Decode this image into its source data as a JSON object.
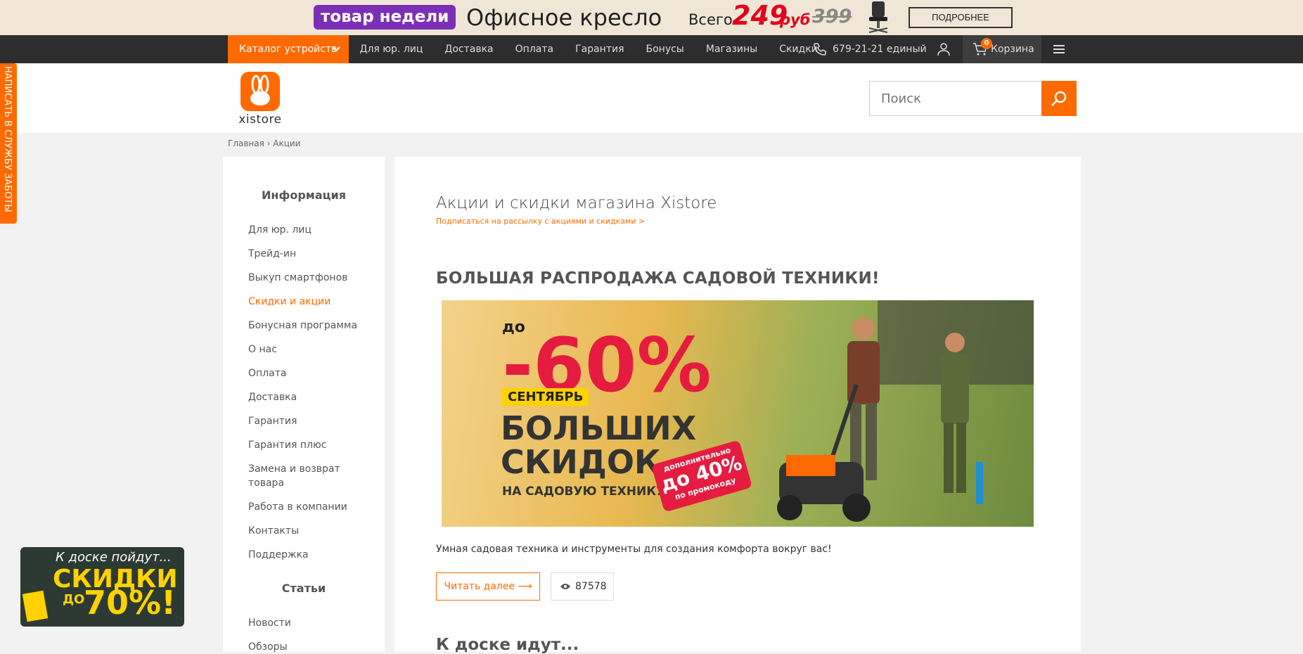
{
  "promo": {
    "badge": "товар недели",
    "title": "Офисное кресло",
    "price_label": "Всего",
    "price": "249",
    "currency": "руб",
    "old_price": "399",
    "more_button": "ПОДРОБНЕЕ"
  },
  "nav": {
    "catalog": "Каталог устройств",
    "links": [
      "Для юр. лиц",
      "Доставка",
      "Оплата",
      "Гарантия",
      "Бонусы",
      "Магазины",
      "Скидки"
    ],
    "phone": "679-21-21 единый",
    "cart_label": "Корзина",
    "cart_count": "0"
  },
  "header": {
    "logo_text": "xistore",
    "search_placeholder": "Поиск"
  },
  "side_tab": "НАПИСАТЬ В СЛУЖБУ ЗАБОТЫ",
  "breadcrumb": "Главная › Акции",
  "sidebar": {
    "heading_info": "Информация",
    "items": [
      "Для юр. лиц",
      "Трейд-ин",
      "Выкуп смартфонов",
      "Скидки и акции",
      "Бонусная программа",
      "О нас",
      "Оплата",
      "Доставка",
      "Гарантия",
      "Гарантия плюс",
      "Замена и возврат товара",
      "Работа в компании",
      "Контакты",
      "Поддержка"
    ],
    "heading_articles": "Статьи",
    "article_items": [
      "Новости",
      "Обзоры"
    ]
  },
  "main": {
    "page_title": "Акции и скидки магазина Xistore",
    "subscribe": "Подписаться на рассылку с акциями и скидками >",
    "article_title": "БОЛЬШАЯ РАСПРОДАЖА САДОВОЙ ТЕХНИКИ!",
    "image": {
      "do": "до",
      "percent": "-60%",
      "month": "СЕНТЯБРЬ",
      "line1": "БОЛЬШИХ",
      "line2": "СКИДОК",
      "line3": "НА САДОВУЮ ТЕХНИКУ",
      "promo_l1": "дополнительно",
      "promo_l2": "до 40%",
      "promo_l3": "по промокоду"
    },
    "article_desc": "Умная садовая техника и инструменты для создания комфорта вокруг вас!",
    "read_more": "Читать далее ⟶",
    "views": "87578",
    "next_title": "К доске идут..."
  },
  "float_ad": {
    "line1": "К доске пойдут...",
    "line2": "СКИДКИ",
    "line3": "ДО",
    "line4": "70%!"
  }
}
